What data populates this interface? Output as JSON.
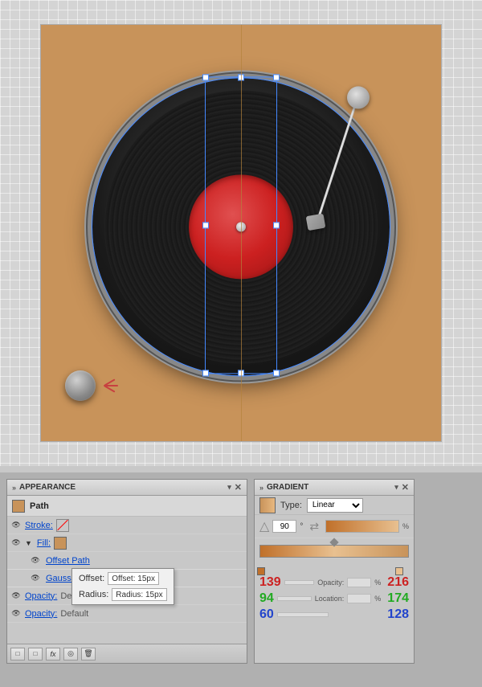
{
  "canvas": {
    "background_color": "#c8935a"
  },
  "appearance_panel": {
    "title": "APPEARANCE",
    "path_label": "Path",
    "stroke_label": "Stroke:",
    "fill_label": "Fill:",
    "offset_path_label": "Offset Path",
    "gaussian_blur_label": "Gaussian Blur",
    "opacity_label1": "Opacity:",
    "opacity_value1": "Default",
    "opacity_label2": "Opacity:",
    "opacity_value2": "Default",
    "offset_value": "Offset: 15px",
    "radius_value": "Radius: 15px"
  },
  "gradient_panel": {
    "title": "GRADIENT",
    "type_label": "Type:",
    "type_value": "Linear",
    "angle_value": "90",
    "rgb_red": "139",
    "rgb_green": "94",
    "rgb_blue": "60",
    "rgb_red2": "216",
    "rgb_green2": "174",
    "rgb_blue2": "128",
    "opacity_label": "Opacity:",
    "location_label": "Location:",
    "percent_sign": "%"
  },
  "toolbar": {
    "new_art_btn": "□",
    "new_str_btn": "□",
    "fx_btn": "fx",
    "clear_btn": "◉",
    "delete_btn": "🗑"
  }
}
